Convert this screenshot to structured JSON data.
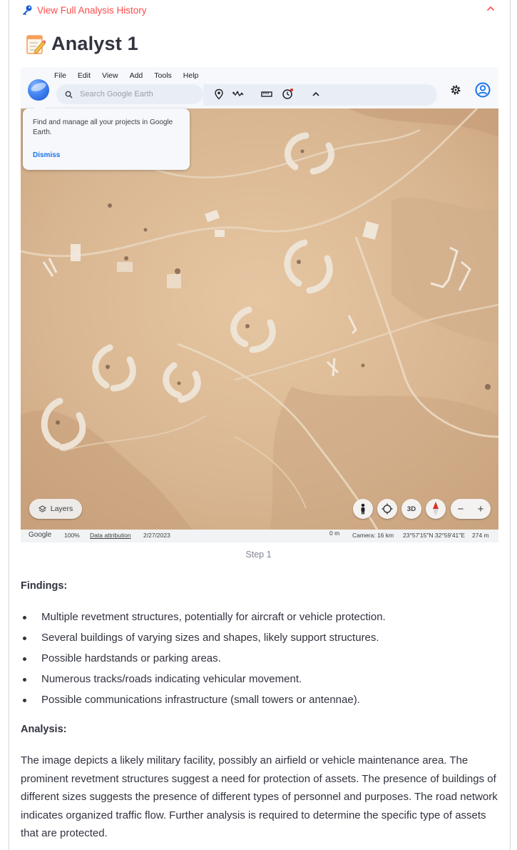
{
  "history": {
    "link_text": "View Full Analysis History"
  },
  "page": {
    "title": "Analyst 1"
  },
  "earth": {
    "menu": [
      "File",
      "Edit",
      "View",
      "Add",
      "Tools",
      "Help"
    ],
    "search_placeholder": "Search Google Earth",
    "popup": {
      "message": "Find and manage all your projects in Google Earth.",
      "dismiss_label": "Dismiss"
    },
    "layers_label": "Layers",
    "three_d_label": "3D",
    "zoom_out": "−",
    "zoom_in": "+",
    "status": {
      "logo": "Google",
      "zoom": "100%",
      "attribution": "Data attribution",
      "date": "2/27/2023",
      "scale": "0 m",
      "camera": "Camera: 16 km",
      "coords": "23°57'15\"N 32°59'41\"E",
      "elevation": "274 m"
    },
    "icons": [
      "google-earth-logo",
      "search-icon",
      "placemark-icon",
      "path-icon",
      "ruler-icon",
      "history-icon",
      "chevron-up-icon",
      "gear-icon",
      "account-icon",
      "layers-icon",
      "pegman-icon",
      "locate-icon",
      "compass-icon"
    ],
    "colors": {
      "accent": "#1a73e8",
      "map_sand": "#d9b896"
    }
  },
  "caption": "Step 1",
  "findings": {
    "title": "Findings:",
    "items": [
      "Multiple revetment structures, potentially for aircraft or vehicle protection.",
      "Several buildings of varying sizes and shapes, likely support structures.",
      "Possible hardstands or parking areas.",
      "Numerous tracks/roads indicating vehicular movement.",
      "Possible communications infrastructure (small towers or antennae)."
    ]
  },
  "analysis": {
    "title": "Analysis:",
    "text": "The image depicts a likely military facility, possibly an airfield or vehicle maintenance area. The prominent revetment structures suggest a need for protection of assets. The presence of buildings of different sizes suggests the presence of different types of personnel and purposes. The road network indicates organized traffic flow. Further analysis is required to determine the specific type of assets that are protected."
  },
  "colors": {
    "link": "#ff4b4b",
    "text": "#31333f",
    "caption": "#808495"
  }
}
